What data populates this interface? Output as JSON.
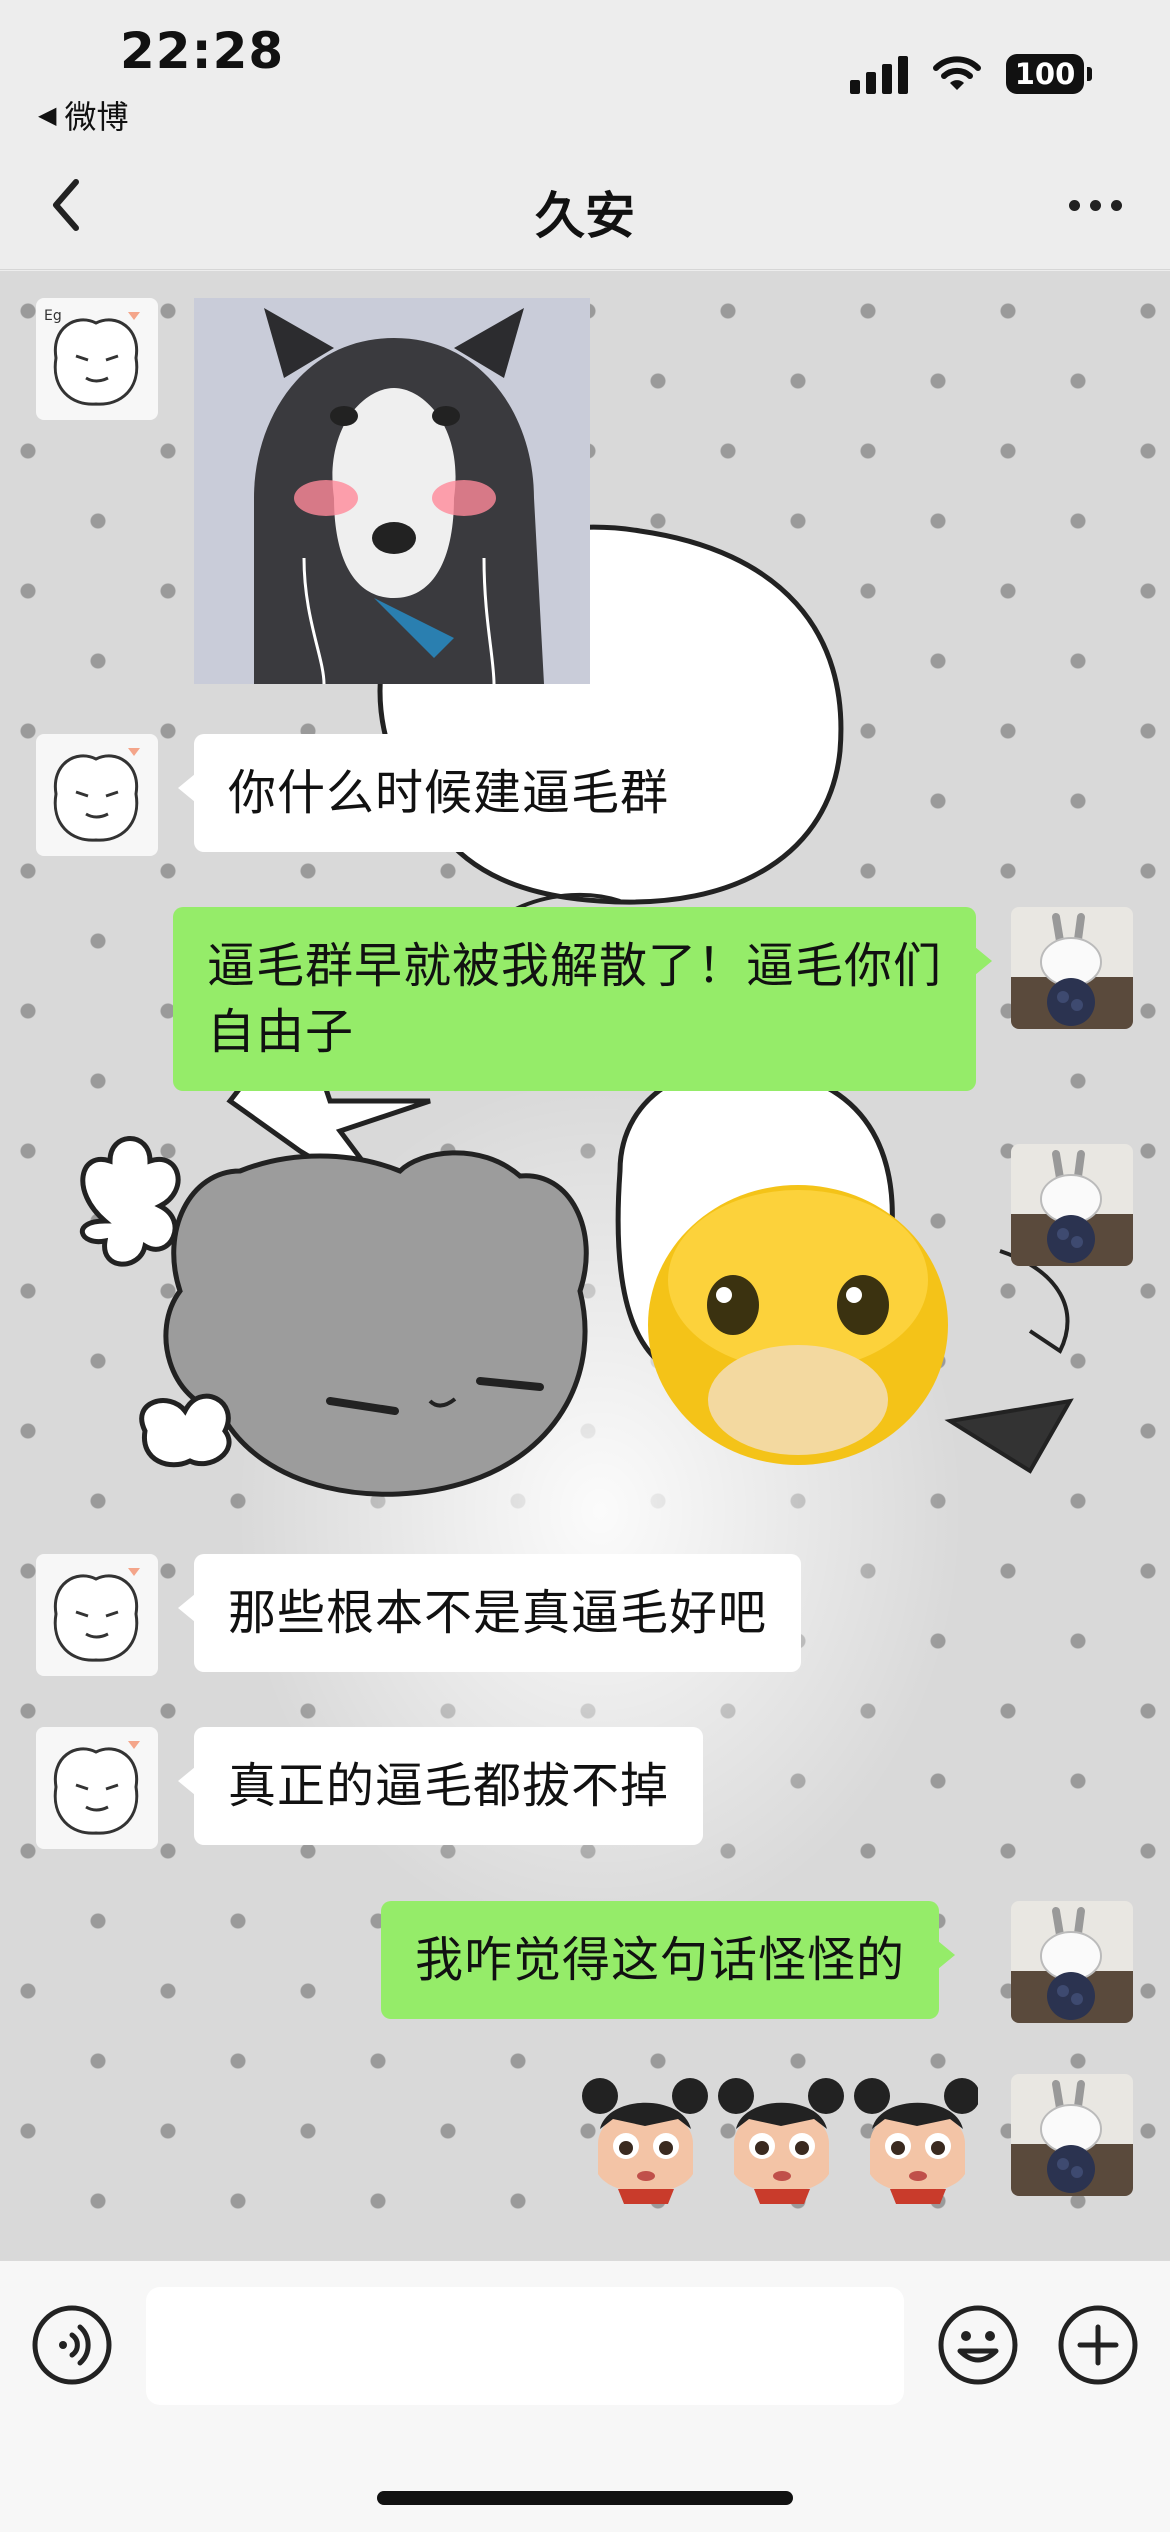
{
  "status_bar": {
    "time": "22:28",
    "back_app": "微博",
    "battery": "100",
    "icons": [
      "signal-icon",
      "wifi-icon",
      "battery-icon"
    ]
  },
  "nav": {
    "title": "久安",
    "back_icon": "chevron-left-icon",
    "more_icon": "more-dots-icon"
  },
  "messages": [
    {
      "side": "in",
      "kind": "image",
      "content": "husky-meme-sticker"
    },
    {
      "side": "in",
      "kind": "text",
      "text": "你什么时候建逼毛群"
    },
    {
      "side": "out",
      "kind": "text",
      "text": "逼毛群早就被我解散了！逼毛你们自由子"
    },
    {
      "side": "out",
      "kind": "sticker",
      "content": "yellow-chick-sticker"
    },
    {
      "side": "in",
      "kind": "text",
      "text": "那些根本不是真逼毛好吧"
    },
    {
      "side": "in",
      "kind": "text",
      "text": "真正的逼毛都拔不掉"
    },
    {
      "side": "out",
      "kind": "text",
      "text": "我咋觉得这句话怪怪的"
    },
    {
      "side": "out",
      "kind": "sticker",
      "content": "three-girl-faces-sticker"
    }
  ],
  "input_bar": {
    "voice_icon": "voice-icon",
    "emoji_icon": "emoji-icon",
    "plus_icon": "plus-icon",
    "value": ""
  },
  "colors": {
    "outgoing_bubble": "#95ec69",
    "incoming_bubble": "#ffffff",
    "background": "#ededed"
  }
}
